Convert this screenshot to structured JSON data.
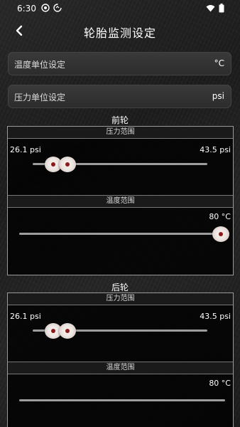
{
  "status": {
    "time": "6:30"
  },
  "header": {
    "title": "轮胎监测设定"
  },
  "settings": {
    "temp_label": "温度单位设定",
    "temp_value": "°C",
    "pressure_label": "压力单位设定",
    "pressure_value": "psi"
  },
  "front": {
    "title": "前轮",
    "pressure_header": "压力范围",
    "pressure_min": "26.1 psi",
    "pressure_max": "43.5 psi",
    "temp_header": "温度范围",
    "temp_value": "80 °C"
  },
  "rear": {
    "title": "后轮",
    "pressure_header": "压力范围",
    "pressure_min": "26.1 psi",
    "pressure_max": "43.5 psi",
    "temp_header": "温度范围",
    "temp_value": "80 °C"
  },
  "colors": {
    "accent": "#8c1a1a",
    "panel_border": "#9a9a9a"
  },
  "icons": [
    "back-arrow-icon",
    "wifi-icon",
    "battery-icon",
    "hotspot-icon",
    "data-saver-icon"
  ]
}
